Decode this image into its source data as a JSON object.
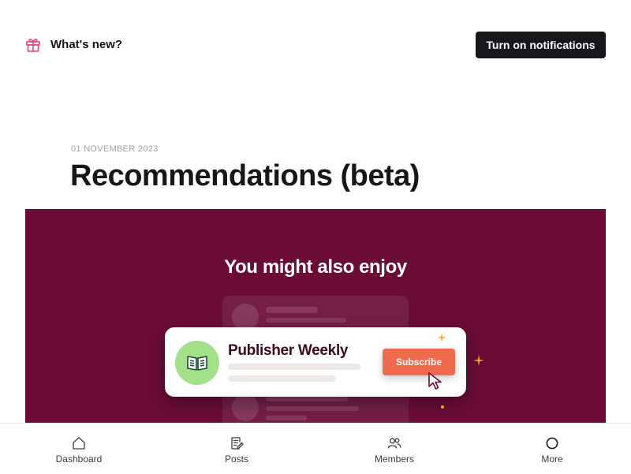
{
  "header": {
    "whats_new_label": "What's new?",
    "notifications_button": "Turn on notifications"
  },
  "post": {
    "date": "01 NOVEMBER 2023",
    "title": "Recommendations (beta)"
  },
  "banner": {
    "heading": "You might also enjoy",
    "card_title": "Publisher Weekly",
    "subscribe_label": "Subscribe",
    "background_color": "#6b0c37",
    "accent_color": "#f06b4e"
  },
  "tabbar": {
    "items": [
      {
        "label": "Dashboard",
        "icon": "home-icon"
      },
      {
        "label": "Posts",
        "icon": "posts-icon"
      },
      {
        "label": "Members",
        "icon": "members-icon"
      },
      {
        "label": "More",
        "icon": "more-icon"
      }
    ]
  }
}
